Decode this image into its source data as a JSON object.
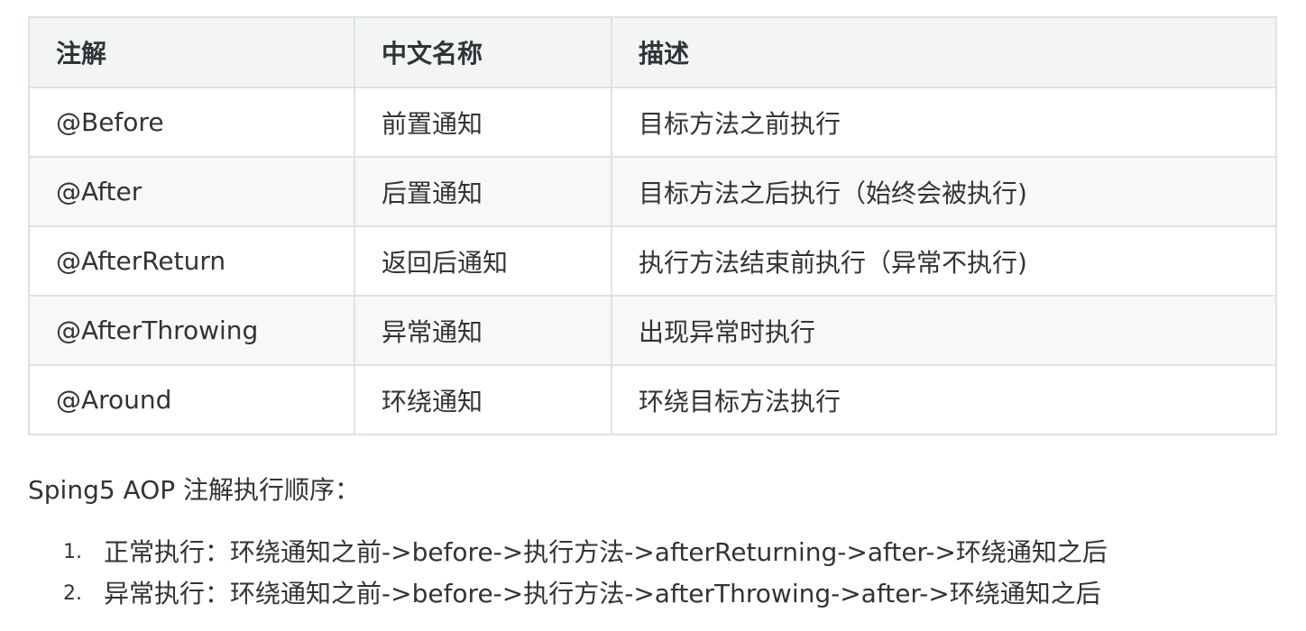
{
  "table": {
    "headers": [
      "注解",
      "中文名称",
      "描述"
    ],
    "rows": [
      [
        "@Before",
        "前置通知",
        "目标方法之前执行"
      ],
      [
        "@After",
        "后置通知",
        "目标方法之后执行（始终会被执行)"
      ],
      [
        "@AfterReturn",
        "返回后通知",
        "执行方法结束前执行（异常不执行)"
      ],
      [
        "@AfterThrowing",
        "异常通知",
        "出现异常时执行"
      ],
      [
        "@Around",
        "环绕通知",
        "环绕目标方法执行"
      ]
    ]
  },
  "order": {
    "title": "Sping5 AOP 注解执行顺序：",
    "items": [
      {
        "num": "1.",
        "text": "正常执行：环绕通知之前->before->执行方法->afterReturning->after->环绕通知之后"
      },
      {
        "num": "2.",
        "text": "异常执行：环绕通知之前->before->执行方法->afterThrowing->after->环绕通知之后"
      }
    ]
  }
}
